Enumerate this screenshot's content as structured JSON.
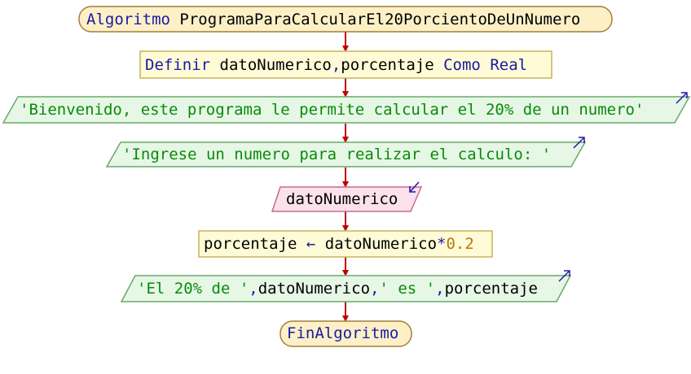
{
  "colors": {
    "terminal_fill": "#fdf0c6",
    "terminal_stroke": "#a07f3a",
    "process_fill": "#fffbd6",
    "process_stroke": "#c9b45a",
    "output_fill": "#e6f7e6",
    "output_stroke": "#6aa86a",
    "input_fill": "#fbe1ea",
    "input_stroke": "#c86a8c",
    "arrow": "#c00000",
    "keyword": "#1a1aa6",
    "string": "#0a8a0a",
    "number": "#b07a10"
  },
  "flowchart": {
    "start": {
      "keyword": "Algoritmo",
      "name": "ProgramaParaCalcularEl20PorcientoDeUnNumero"
    },
    "define": {
      "keyword": "Definir",
      "vars": "datoNumerico",
      "comma": ",",
      "vars2": "porcentaje",
      "como": "Como",
      "type": "Real"
    },
    "write1": {
      "text": "'Bienvenido, este programa le permite calcular el 20% de un numero'"
    },
    "write2": {
      "text": "'Ingrese un numero para realizar el calculo: '"
    },
    "read": {
      "var": "datoNumerico"
    },
    "assign": {
      "target": "porcentaje",
      "arrow": "←",
      "source": "datoNumerico",
      "op": "*",
      "value": "0.2"
    },
    "write3": {
      "s1": "'El 20% de '",
      "c1": ",",
      "v1": "datoNumerico",
      "c2": ",",
      "s2": "' es '",
      "c3": ",",
      "v2": "porcentaje"
    },
    "end": {
      "keyword": "FinAlgoritmo"
    }
  }
}
